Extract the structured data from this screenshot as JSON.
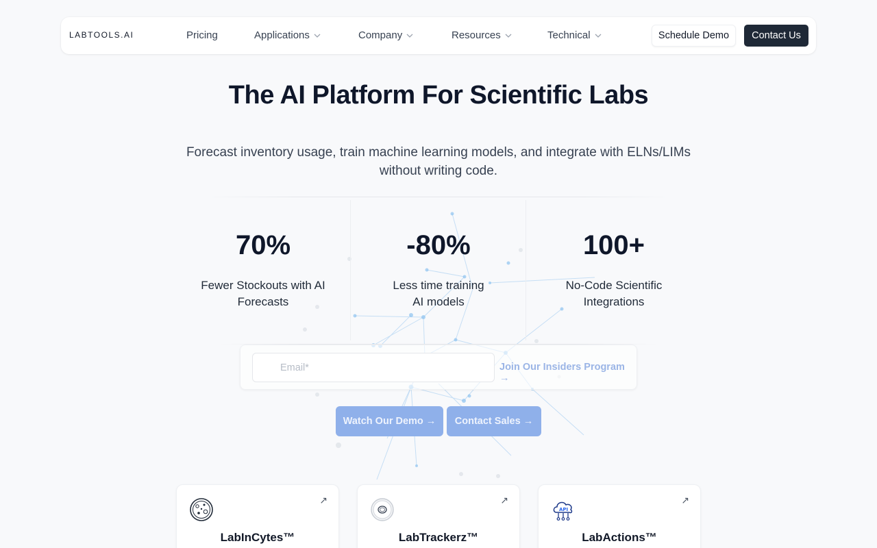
{
  "nav": {
    "logo": "LABTOOLS.AI",
    "links": [
      {
        "label": "Pricing",
        "has_dropdown": false
      },
      {
        "label": "Applications",
        "has_dropdown": true
      },
      {
        "label": "Company",
        "has_dropdown": true
      },
      {
        "label": "Resources",
        "has_dropdown": true
      },
      {
        "label": "Technical",
        "has_dropdown": true
      }
    ],
    "schedule_label": "Schedule Demo",
    "contact_label": "Contact Us"
  },
  "hero": {
    "title": "The AI Platform For Scientific Labs",
    "subtitle": "Forecast inventory usage, train machine learning models, and integrate with ELNs/LIMs without writing code."
  },
  "stats": [
    {
      "value": "70%",
      "label": "Fewer Stockouts with AI Forecasts"
    },
    {
      "value": "-80%",
      "label": "Less time training AI models"
    },
    {
      "value": "100+",
      "label": "No-Code Scientific Integrations"
    }
  ],
  "signup": {
    "email_placeholder": "Email*",
    "join_label": "Join Our Insiders Program →"
  },
  "cta": {
    "demo_label": "Watch Our Demo →",
    "sales_label": "Contact Sales →"
  },
  "cards": [
    {
      "title": "LabInCytes™",
      "icon": "petri-dish-icon",
      "arrow": "↗"
    },
    {
      "title": "LabTrackerz™",
      "icon": "tape-roll-icon",
      "arrow": "↗"
    },
    {
      "title": "LabActions™",
      "icon": "api-cloud-icon",
      "arrow": "↗"
    }
  ],
  "colors": {
    "primary_dark": "#1f2937",
    "cta_blue": "#8fb0ea",
    "link_blue": "#9bb5e6",
    "background": "#f8f9fb"
  }
}
